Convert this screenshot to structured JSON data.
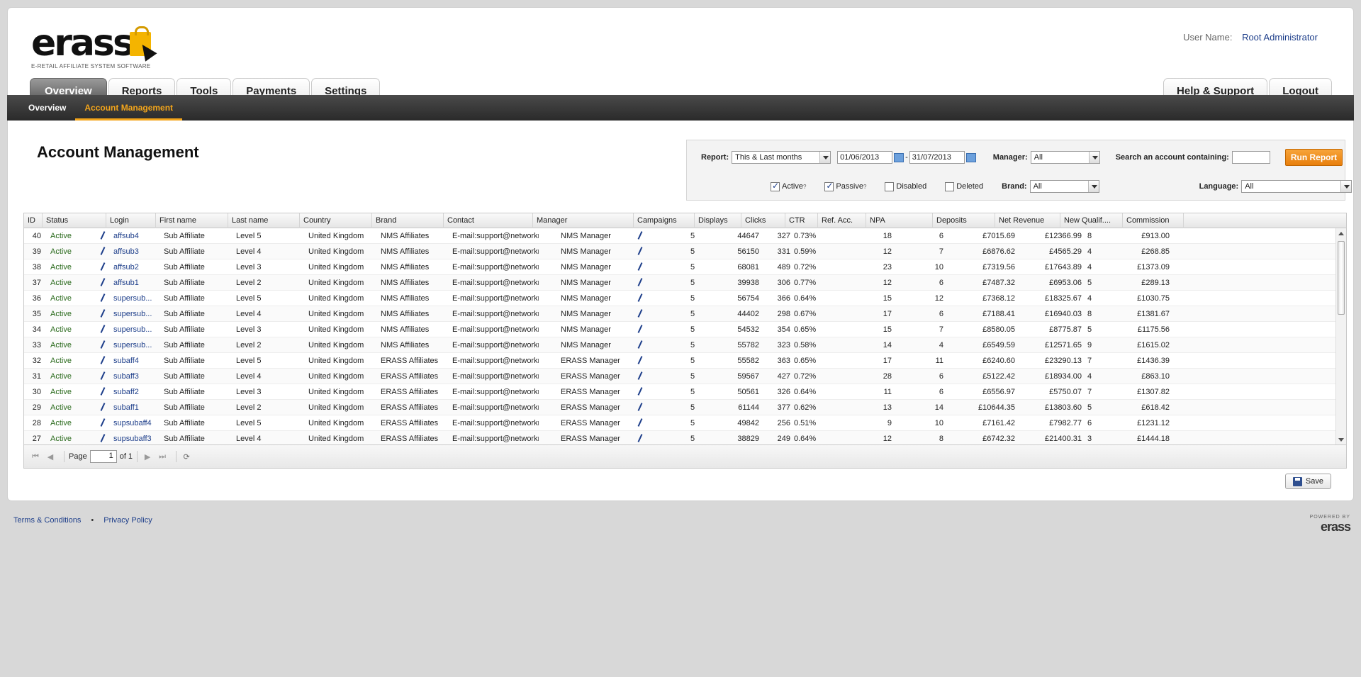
{
  "brand": {
    "name": "erass",
    "tagline": "E-RETAIL AFFILIATE SYSTEM SOFTWARE",
    "accent": "#f3a51b"
  },
  "user": {
    "label": "User Name:",
    "value": "Root Administrator"
  },
  "tabs": [
    {
      "label": "Overview",
      "active": true
    },
    {
      "label": "Reports"
    },
    {
      "label": "Tools"
    },
    {
      "label": "Payments"
    },
    {
      "label": "Settings"
    }
  ],
  "tabs_right": [
    {
      "label": "Help & Support"
    },
    {
      "label": "Logout"
    }
  ],
  "subnav": [
    {
      "label": "Overview"
    },
    {
      "label": "Account Management",
      "active": true
    }
  ],
  "page_title": "Account Management",
  "filter": {
    "report_label": "Report:",
    "report_value": "This & Last months",
    "date_from": "01/06/2013",
    "date_sep": "-",
    "date_to": "31/07/2013",
    "manager_label": "Manager:",
    "manager_value": "All",
    "search_label": "Search an account containing:",
    "search_value": "",
    "run_label": "Run Report",
    "cb_active": "Active",
    "cb_passive": "Passive",
    "cb_disabled": "Disabled",
    "cb_deleted": "Deleted",
    "help_mark": "?",
    "brand_label": "Brand:",
    "brand_value": "All",
    "language_label": "Language:",
    "language_value": "All"
  },
  "columns": [
    "ID",
    "Status",
    "Login",
    "First name",
    "Last name",
    "Country",
    "Brand",
    "Contact",
    "Manager",
    "Campaigns",
    "Displays",
    "Clicks",
    "CTR",
    "Ref. Acc.",
    "NPA",
    "Deposits",
    "Net Revenue",
    "New Qualif....",
    "Commission"
  ],
  "rows": [
    [
      "40",
      "Active",
      "affsub4",
      "Sub Affiliate",
      "Level 5",
      "United Kingdom",
      "NMS Affiliates",
      "E-mail:support@networkm...",
      "NMS Manager",
      "5",
      "44647",
      "327",
      "0.73%",
      "18",
      "6",
      "£7015.69",
      "£12366.99",
      "8",
      "£913.00"
    ],
    [
      "39",
      "Active",
      "affsub3",
      "Sub Affiliate",
      "Level 4",
      "United Kingdom",
      "NMS Affiliates",
      "E-mail:support@networkm...",
      "NMS Manager",
      "5",
      "56150",
      "331",
      "0.59%",
      "12",
      "7",
      "£6876.62",
      "£4565.29",
      "4",
      "£268.85"
    ],
    [
      "38",
      "Active",
      "affsub2",
      "Sub Affiliate",
      "Level 3",
      "United Kingdom",
      "NMS Affiliates",
      "E-mail:support@networkm...",
      "NMS Manager",
      "5",
      "68081",
      "489",
      "0.72%",
      "23",
      "10",
      "£7319.56",
      "£17643.89",
      "4",
      "£1373.09"
    ],
    [
      "37",
      "Active",
      "affsub1",
      "Sub Affiliate",
      "Level 2",
      "United Kingdom",
      "NMS Affiliates",
      "E-mail:support@networkm...",
      "NMS Manager",
      "5",
      "39938",
      "306",
      "0.77%",
      "12",
      "6",
      "£7487.32",
      "£6953.06",
      "5",
      "£289.13"
    ],
    [
      "36",
      "Active",
      "supersub...",
      "Sub Affiliate",
      "Level 5",
      "United Kingdom",
      "NMS Affiliates",
      "E-mail:support@networkm...",
      "NMS Manager",
      "5",
      "56754",
      "366",
      "0.64%",
      "15",
      "12",
      "£7368.12",
      "£18325.67",
      "4",
      "£1030.75"
    ],
    [
      "35",
      "Active",
      "supersub...",
      "Sub Affiliate",
      "Level 4",
      "United Kingdom",
      "NMS Affiliates",
      "E-mail:support@networkm...",
      "NMS Manager",
      "5",
      "44402",
      "298",
      "0.67%",
      "17",
      "6",
      "£7188.41",
      "£16940.03",
      "8",
      "£1381.67"
    ],
    [
      "34",
      "Active",
      "supersub...",
      "Sub Affiliate",
      "Level 3",
      "United Kingdom",
      "NMS Affiliates",
      "E-mail:support@networkm...",
      "NMS Manager",
      "5",
      "54532",
      "354",
      "0.65%",
      "15",
      "7",
      "£8580.05",
      "£8775.87",
      "5",
      "£1175.56"
    ],
    [
      "33",
      "Active",
      "supersub...",
      "Sub Affiliate",
      "Level 2",
      "United Kingdom",
      "NMS Affiliates",
      "E-mail:support@networkm...",
      "NMS Manager",
      "5",
      "55782",
      "323",
      "0.58%",
      "14",
      "4",
      "£6549.59",
      "£12571.65",
      "9",
      "£1615.02"
    ],
    [
      "32",
      "Active",
      "subaff4",
      "Sub Affiliate",
      "Level 5",
      "United Kingdom",
      "ERASS Affiliates",
      "E-mail:support@networkm...",
      "ERASS Manager",
      "5",
      "55582",
      "363",
      "0.65%",
      "17",
      "11",
      "£6240.60",
      "£23290.13",
      "7",
      "£1436.39"
    ],
    [
      "31",
      "Active",
      "subaff3",
      "Sub Affiliate",
      "Level 4",
      "United Kingdom",
      "ERASS Affiliates",
      "E-mail:support@networkm...",
      "ERASS Manager",
      "5",
      "59567",
      "427",
      "0.72%",
      "28",
      "6",
      "£5122.42",
      "£18934.00",
      "4",
      "£863.10"
    ],
    [
      "30",
      "Active",
      "subaff2",
      "Sub Affiliate",
      "Level 3",
      "United Kingdom",
      "ERASS Affiliates",
      "E-mail:support@networkm...",
      "ERASS Manager",
      "5",
      "50561",
      "326",
      "0.64%",
      "11",
      "6",
      "£6556.97",
      "£5750.07",
      "7",
      "£1307.82"
    ],
    [
      "29",
      "Active",
      "subaff1",
      "Sub Affiliate",
      "Level 2",
      "United Kingdom",
      "ERASS Affiliates",
      "E-mail:support@networkm...",
      "ERASS Manager",
      "5",
      "61144",
      "377",
      "0.62%",
      "13",
      "14",
      "£10644.35",
      "£13803.60",
      "5",
      "£618.42"
    ],
    [
      "28",
      "Active",
      "supsubaff4",
      "Sub Affiliate",
      "Level 5",
      "United Kingdom",
      "ERASS Affiliates",
      "E-mail:support@networkm...",
      "ERASS Manager",
      "5",
      "49842",
      "256",
      "0.51%",
      "9",
      "10",
      "£7161.42",
      "£7982.77",
      "6",
      "£1231.12"
    ],
    [
      "27",
      "Active",
      "supsubaff3",
      "Sub Affiliate",
      "Level 4",
      "United Kingdom",
      "ERASS Affiliates",
      "E-mail:support@networkm...",
      "ERASS Manager",
      "5",
      "38829",
      "249",
      "0.64%",
      "12",
      "8",
      "£6742.32",
      "£21400.31",
      "3",
      "£1444.18"
    ]
  ],
  "pager": {
    "page_label": "Page",
    "page_value": "1",
    "of_label": "of 1"
  },
  "save_label": "Save",
  "footer": {
    "terms": "Terms & Conditions",
    "dot": "•",
    "privacy": "Privacy Policy"
  },
  "powered": {
    "line1": "POWERED BY",
    "line2": "erass"
  }
}
